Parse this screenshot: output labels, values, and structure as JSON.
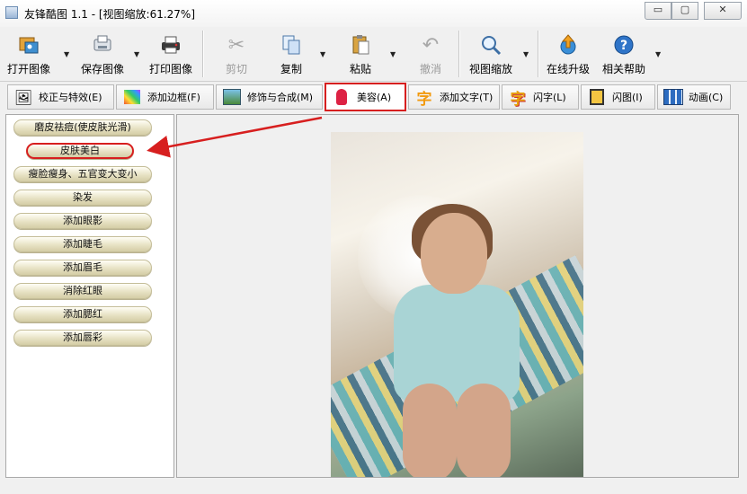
{
  "window": {
    "title": "友锋酷图 1.1 - [视图缩放:61.27%]",
    "controls": {
      "minimize": "▭",
      "maximize": "▢",
      "close": "✕"
    }
  },
  "toolbar": {
    "buttons": [
      {
        "label": "打开图像",
        "icon": "open-image-icon",
        "disabled": false,
        "dropdown": true
      },
      {
        "label": "保存图像",
        "icon": "save-image-icon",
        "disabled": false,
        "dropdown": true
      },
      {
        "label": "打印图像",
        "icon": "printer-icon",
        "disabled": false,
        "dropdown": false
      },
      {
        "label": "剪切",
        "icon": "scissors-icon",
        "disabled": true,
        "dropdown": false
      },
      {
        "label": "复制",
        "icon": "copy-icon",
        "disabled": false,
        "dropdown": true
      },
      {
        "label": "粘贴",
        "icon": "paste-icon",
        "disabled": false,
        "dropdown": true
      },
      {
        "label": "撤消",
        "icon": "undo-icon",
        "disabled": true,
        "dropdown": false
      },
      {
        "label": "视图缩放",
        "icon": "zoom-icon",
        "disabled": false,
        "dropdown": true
      },
      {
        "label": "在线升级",
        "icon": "online-upgrade-icon",
        "disabled": false,
        "dropdown": false
      },
      {
        "label": "相关帮助",
        "icon": "help-icon",
        "disabled": false,
        "dropdown": true
      }
    ]
  },
  "tabs": [
    {
      "label": "校正与特效(E)",
      "icon": "correction-effects-icon",
      "active": false
    },
    {
      "label": "添加边框(F)",
      "icon": "add-frame-icon",
      "active": false
    },
    {
      "label": "修饰与合成(M)",
      "icon": "compose-icon",
      "active": false
    },
    {
      "label": "美容(A)",
      "icon": "beauty-icon",
      "active": true
    },
    {
      "label": "添加文字(T)",
      "icon": "add-text-icon",
      "active": false
    },
    {
      "label": "闪字(L)",
      "icon": "flash-text-icon",
      "active": false
    },
    {
      "label": "闪图(I)",
      "icon": "flash-image-icon",
      "active": false
    },
    {
      "label": "动画(C)",
      "icon": "animation-icon",
      "active": false
    }
  ],
  "functions": [
    {
      "label": "磨皮祛痘(使皮肤光滑)",
      "selected": false
    },
    {
      "label": "皮肤美白",
      "selected": true
    },
    {
      "label": "瘦脸瘦身、五官变大变小",
      "selected": false
    },
    {
      "label": "染发",
      "selected": false
    },
    {
      "label": "添加眼影",
      "selected": false
    },
    {
      "label": "添加睫毛",
      "selected": false
    },
    {
      "label": "添加眉毛",
      "selected": false
    },
    {
      "label": "消除红眼",
      "selected": false
    },
    {
      "label": "添加腮红",
      "selected": false
    },
    {
      "label": "添加唇彩",
      "selected": false
    }
  ],
  "colors": {
    "highlight": "#d71f1f",
    "button_face": "#e7e2c4",
    "window_bg": "#f0f0f0"
  }
}
